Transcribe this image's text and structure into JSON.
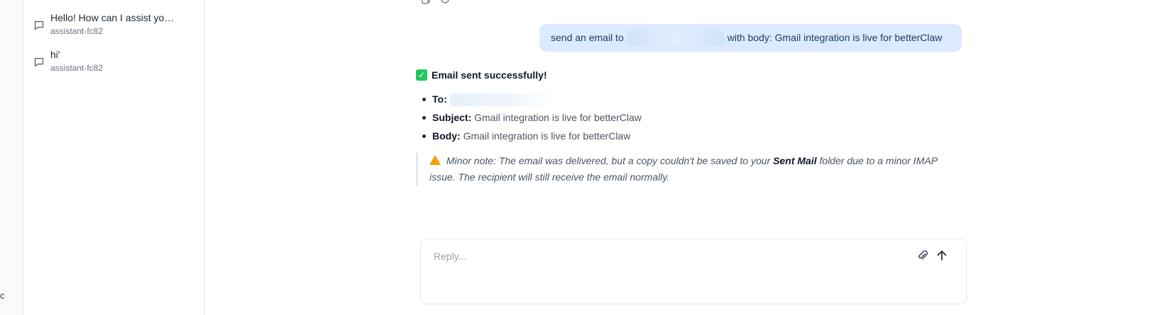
{
  "rail": {
    "glyph": "c"
  },
  "sidebar": {
    "conversations": [
      {
        "title": "Hello! How can I assist yo…",
        "subtitle": "assistant-fc82",
        "icon": "chat-bubble-icon"
      },
      {
        "title": "hi'",
        "subtitle": "assistant-fc82",
        "icon": "chat-bubble-icon"
      }
    ]
  },
  "toolbar": {
    "icons": [
      "copy-icon",
      "refresh-icon"
    ]
  },
  "user_message": {
    "prefix": "send an email to",
    "suffix": "with body: Gmail integration is live for betterClaw"
  },
  "assistant_message": {
    "headline_emoji": "check-mark-icon",
    "headline": "Email sent successfully!",
    "details": [
      {
        "label": "To:",
        "value": ""
      },
      {
        "label": "Subject:",
        "value": "Gmail integration is live for betterClaw"
      },
      {
        "label": "Body:",
        "value": "Gmail integration is live for betterClaw"
      }
    ],
    "note": {
      "icon": "warning-icon",
      "before": "Minor note: The email was delivered, but a copy couldn't be saved to your",
      "emphasis": "Sent Mail",
      "after": "folder due to a minor IMAP issue. The recipient will still receive the email normally."
    }
  },
  "composer": {
    "placeholder": "Reply...",
    "value": "",
    "attach_icon": "paperclip-icon",
    "send_icon": "arrow-up-icon"
  },
  "colors": {
    "bubble": "#dbeafe",
    "accent_text": "#1e3a5f",
    "success": "#22c55e",
    "warning": "#f59e0b"
  }
}
